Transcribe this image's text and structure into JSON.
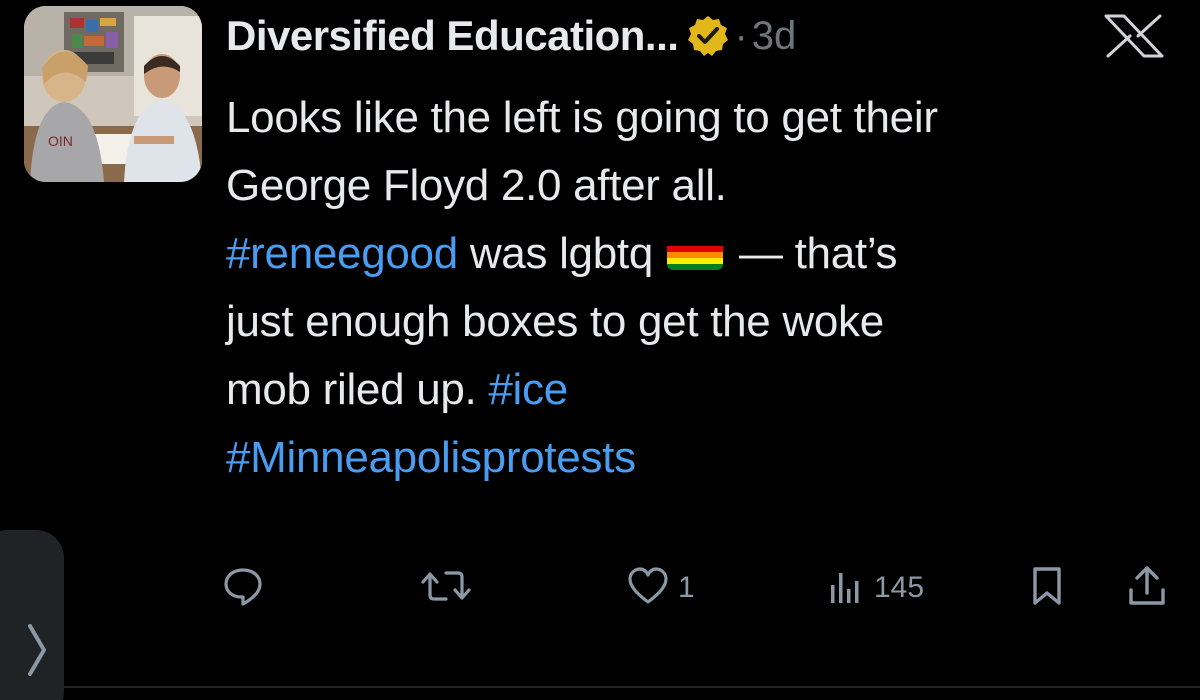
{
  "author": {
    "display_name": "Diversified Education...",
    "verified_badge": "gold-verified-check-icon",
    "separator": "·",
    "timestamp": "3d"
  },
  "platform_logo": "x-logo-icon",
  "tweet": {
    "lines": [
      [
        {
          "text": "Looks like the left is going to get their",
          "type": "text"
        }
      ],
      [
        {
          "text": "George Floyd 2.0 after all.",
          "type": "text"
        }
      ],
      [
        {
          "text": "#reneegood",
          "type": "hashtag"
        },
        {
          "text": " was lgbtq",
          "type": "text"
        },
        {
          "text": "rainbow-flag",
          "type": "emoji"
        },
        {
          "text": "— that’s",
          "type": "text"
        }
      ],
      [
        {
          "text": "just enough boxes to get the woke",
          "type": "text"
        }
      ],
      [
        {
          "text": "mob riled up. ",
          "type": "text"
        },
        {
          "text": "#ice",
          "type": "hashtag"
        }
      ],
      [
        {
          "text": "#Minneapolisprotests",
          "type": "hashtag"
        }
      ]
    ]
  },
  "actions": {
    "reply": {
      "icon": "reply-icon",
      "count": ""
    },
    "repost": {
      "icon": "repost-icon",
      "count": ""
    },
    "like": {
      "icon": "heart-icon",
      "count": "1"
    },
    "views": {
      "icon": "views-icon",
      "count": "145"
    },
    "bookmark": {
      "icon": "bookmark-icon"
    },
    "share": {
      "icon": "share-icon"
    }
  },
  "colors": {
    "background": "#000000",
    "text": "#e7e9ea",
    "muted": "#71767b",
    "hashtag": "#4a9cf0",
    "verified": "#e2b719"
  }
}
